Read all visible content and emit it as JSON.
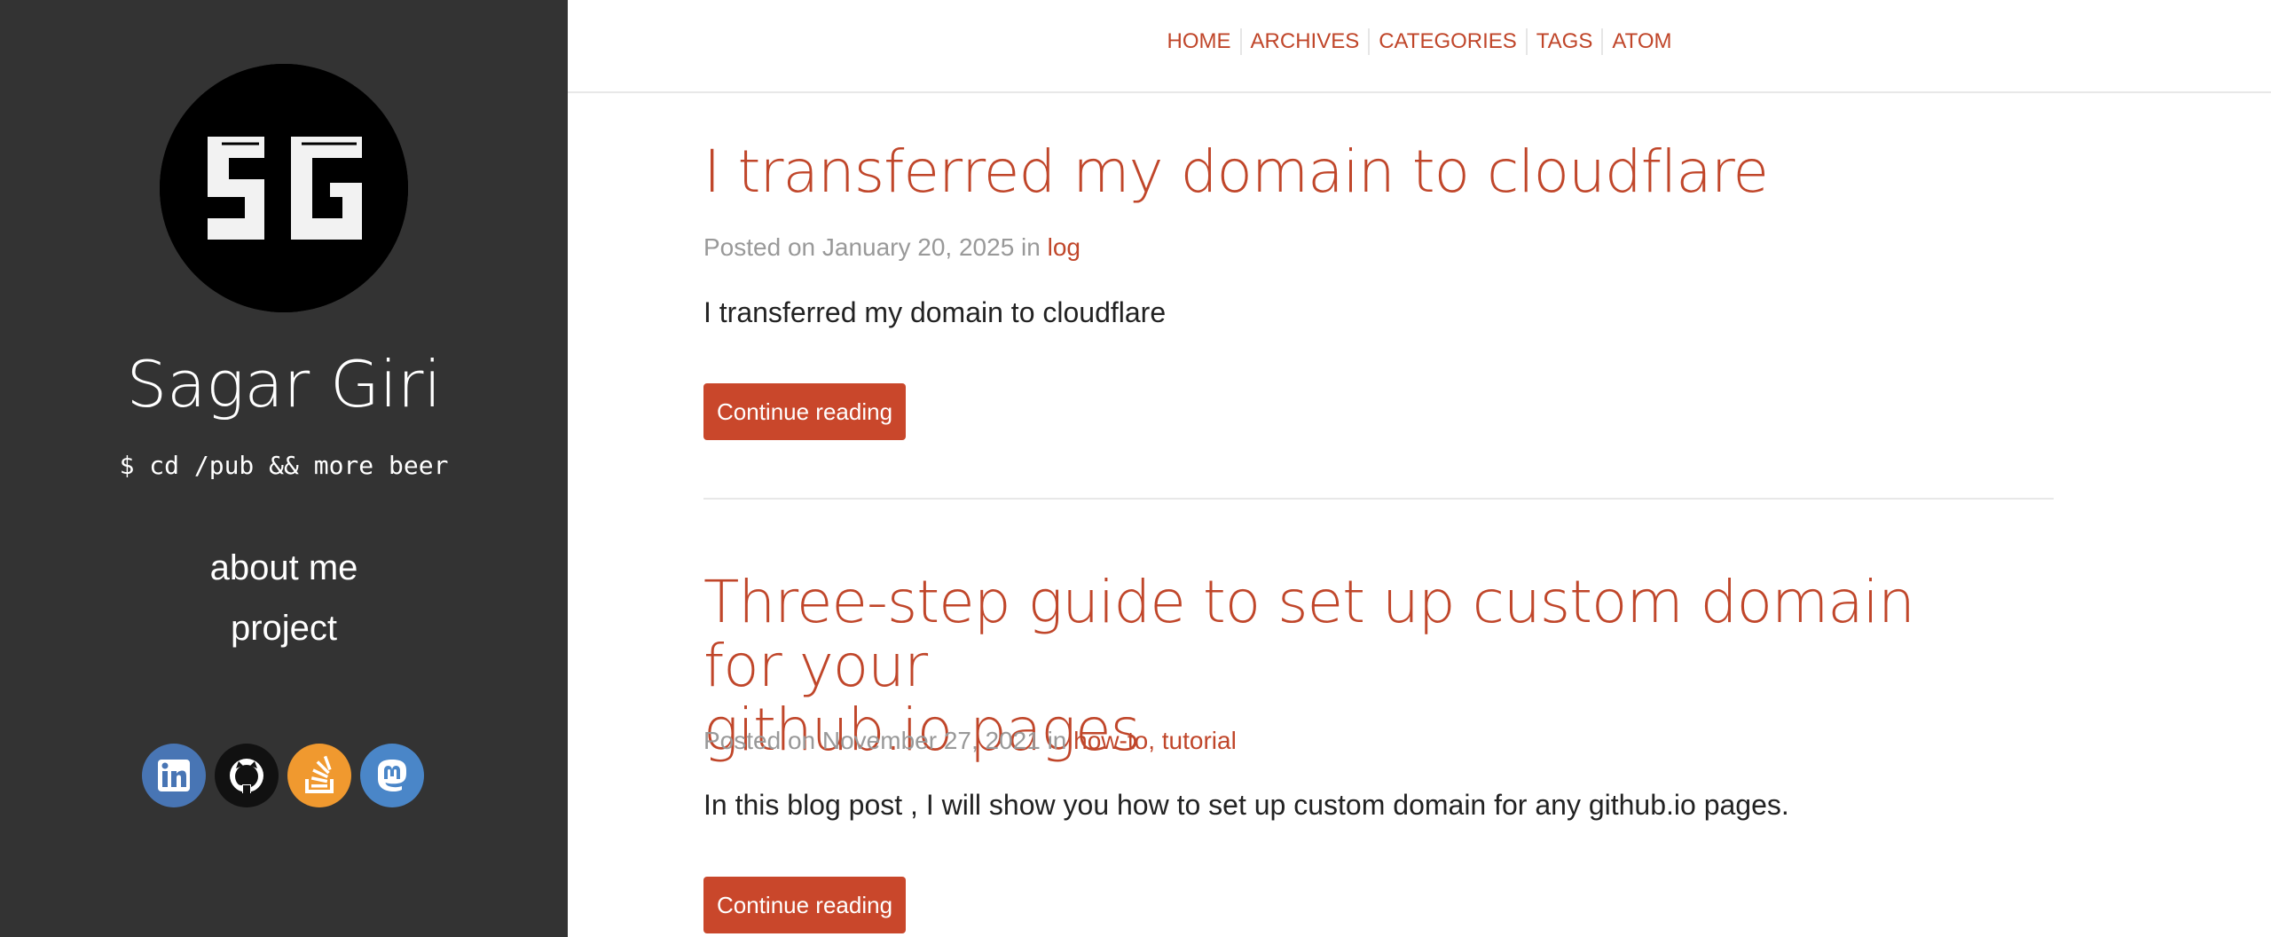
{
  "sidebar": {
    "avatar": {
      "monogram": "SG",
      "icon": "sg-logo"
    },
    "title": "Sagar Giri",
    "tagline": "$ cd /pub && more beer",
    "links": [
      "about me",
      "project"
    ],
    "socials": [
      {
        "name": "linkedin",
        "icon": "linkedin-icon",
        "color": "#4875b4"
      },
      {
        "name": "github",
        "icon": "github-icon",
        "color": "#111111"
      },
      {
        "name": "stackoverflow",
        "icon": "stackoverflow-icon",
        "color": "#f48024"
      },
      {
        "name": "mastodon",
        "icon": "mastodon-icon",
        "color": "#4a86c8"
      }
    ]
  },
  "nav": {
    "items": [
      "HOME",
      "ARCHIVES",
      "CATEGORIES",
      "TAGS",
      "ATOM"
    ]
  },
  "posts": [
    {
      "title": "I transferred my domain to cloudflare",
      "meta_prefix": "Posted on January 20, 2025 in ",
      "categories": "log",
      "excerpt": "I transferred my domain to cloudflare",
      "button": "Continue reading"
    },
    {
      "title_line1": "Three-step guide to set up custom domain for your",
      "title_line2": "github.io pages",
      "meta_prefix": "Posted on November 27, 2021 in ",
      "categories": "how-to, tutorial",
      "excerpt": "In this blog post , I will show you how to set up custom domain for any github.io pages.",
      "button": "Continue reading"
    }
  ],
  "colors": {
    "accent": "#c0462a",
    "sidebar_bg": "#333333"
  }
}
